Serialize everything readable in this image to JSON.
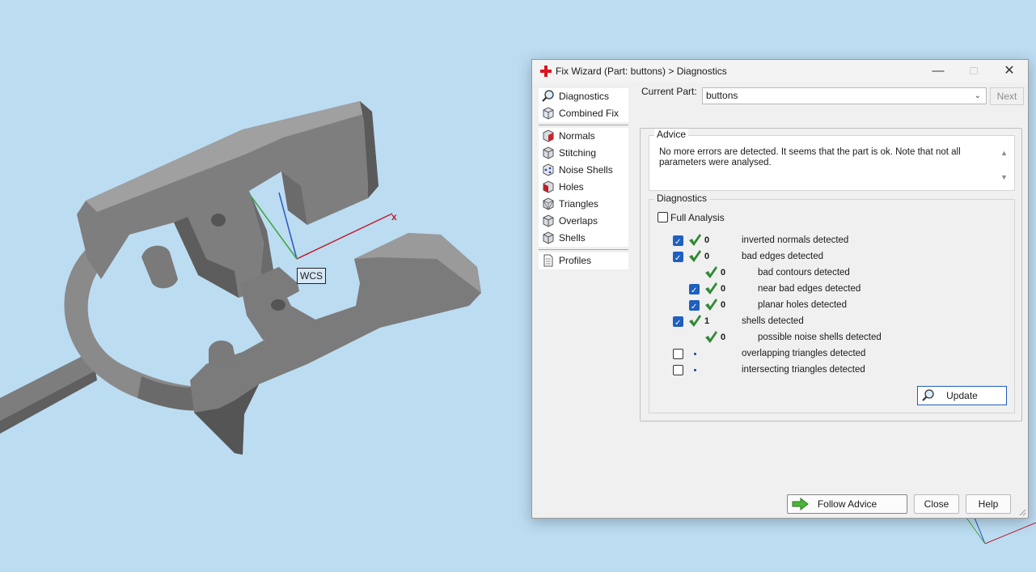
{
  "viewport": {
    "wcs_label": "WCS",
    "x_axis_label": "x"
  },
  "dialog": {
    "title": "Fix Wizard (Part: buttons) > Diagnostics",
    "nav": {
      "top": [
        {
          "label": "Diagnostics",
          "icon": "magnifier-icon"
        },
        {
          "label": "Combined Fix",
          "icon": "cube-icon"
        }
      ],
      "middle": [
        {
          "label": "Normals",
          "icon": "normals-cube-icon"
        },
        {
          "label": "Stitching",
          "icon": "stitching-cube-icon"
        },
        {
          "label": "Noise Shells",
          "icon": "noise-shells-icon"
        },
        {
          "label": "Holes",
          "icon": "holes-cube-icon"
        },
        {
          "label": "Triangles",
          "icon": "triangles-cube-icon"
        },
        {
          "label": "Overlaps",
          "icon": "overlaps-cube-icon"
        },
        {
          "label": "Shells",
          "icon": "shells-cube-icon"
        }
      ],
      "bottom": [
        {
          "label": "Profiles",
          "icon": "document-icon"
        }
      ]
    },
    "current_part": {
      "label": "Current Part:",
      "value": "buttons"
    },
    "next_label": "Next",
    "advice": {
      "legend": "Advice",
      "text": "No more errors are detected. It seems that the part is ok. Note that not all parameters were analysed."
    },
    "diagnostics": {
      "legend": "Diagnostics",
      "full_analysis_label": "Full Analysis",
      "full_analysis_checked": false,
      "rows": [
        {
          "checkbox": true,
          "checked": true,
          "status": "ok",
          "count": "0",
          "label": "inverted normals detected",
          "indent": 0
        },
        {
          "checkbox": true,
          "checked": true,
          "status": "ok",
          "count": "0",
          "label": "bad edges detected",
          "indent": 0
        },
        {
          "checkbox": false,
          "checked": false,
          "status": "ok",
          "count": "0",
          "label": "bad contours detected",
          "indent": 1
        },
        {
          "checkbox": true,
          "checked": true,
          "status": "ok",
          "count": "0",
          "label": "near bad edges detected",
          "indent": 1
        },
        {
          "checkbox": true,
          "checked": true,
          "status": "ok",
          "count": "0",
          "label": "planar holes detected",
          "indent": 1
        },
        {
          "checkbox": true,
          "checked": true,
          "status": "ok",
          "count": "1",
          "label": "shells detected",
          "indent": 0
        },
        {
          "checkbox": false,
          "checked": false,
          "status": "ok",
          "count": "0",
          "label": "possible noise shells detected",
          "indent": 1
        },
        {
          "checkbox": true,
          "checked": false,
          "status": "none",
          "count": "",
          "label": "overlapping triangles detected",
          "indent": 0
        },
        {
          "checkbox": true,
          "checked": false,
          "status": "none",
          "count": "",
          "label": "intersecting triangles detected",
          "indent": 0
        }
      ],
      "update_label": "Update"
    },
    "footer": {
      "follow_advice_label": "Follow Advice",
      "close_label": "Close",
      "help_label": "Help"
    }
  }
}
